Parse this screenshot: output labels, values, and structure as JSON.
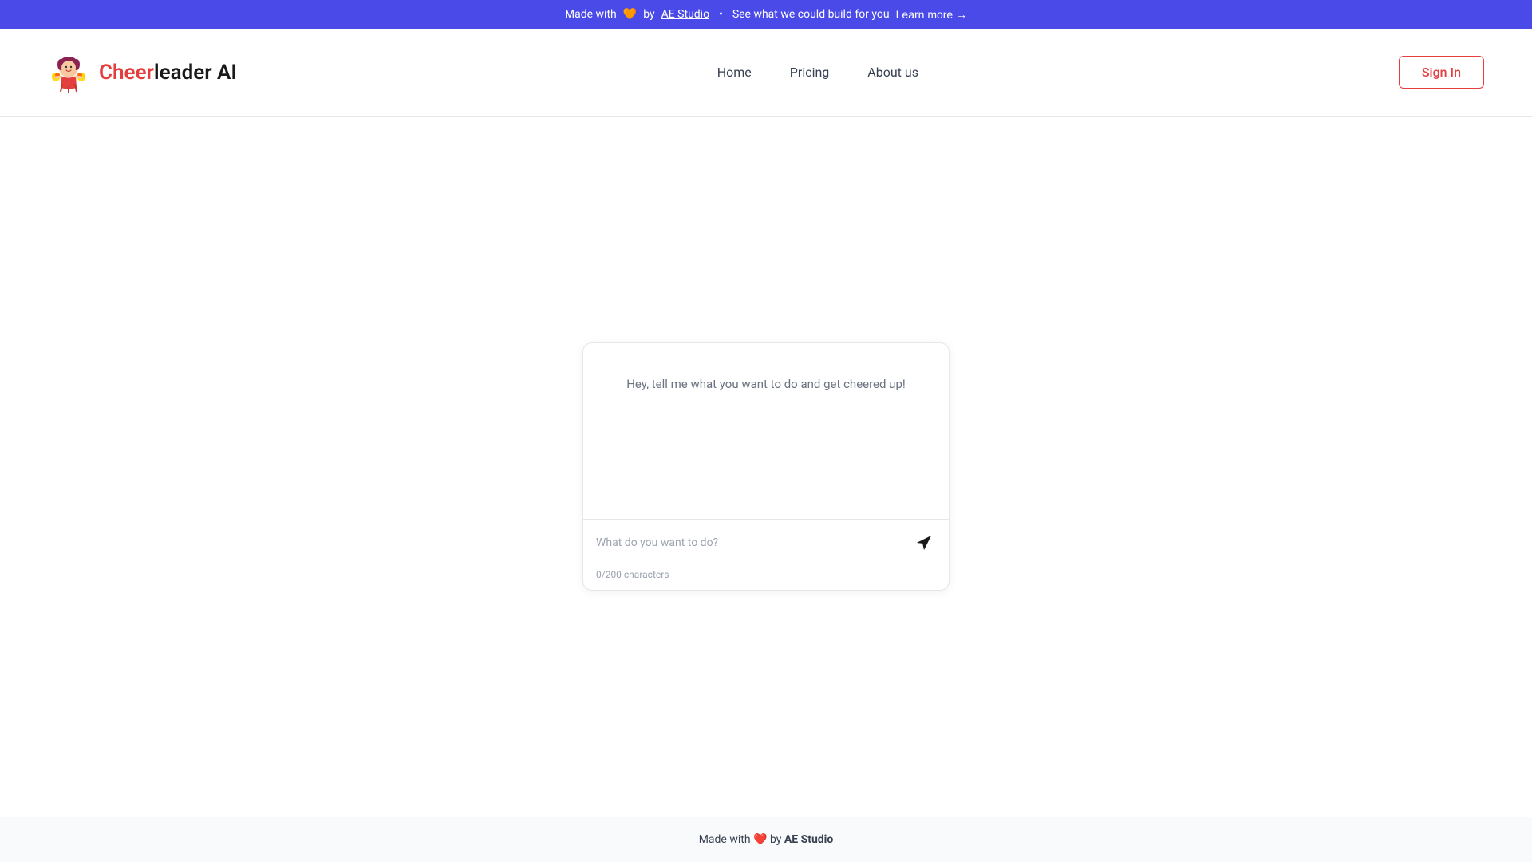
{
  "banner": {
    "made_with": "Made with",
    "heart": "🧡",
    "by": "by",
    "ae_studio_link": "AE Studio",
    "bullet": "•",
    "see_what": "See what we could build for you",
    "learn_more": "Learn more →"
  },
  "header": {
    "logo_text_cheer": "Cheer",
    "logo_text_rest": "leader AI",
    "nav": {
      "home": "Home",
      "pricing": "Pricing",
      "about_us": "About us"
    },
    "sign_in": "Sign In"
  },
  "chat": {
    "placeholder_message": "Hey, tell me what you want to do and get cheered up!",
    "input_placeholder": "What do you want to do?",
    "char_count": "0/200 characters"
  },
  "footer": {
    "made_with": "Made with",
    "heart": "❤️",
    "by": "by",
    "ae_studio": "AE Studio"
  }
}
